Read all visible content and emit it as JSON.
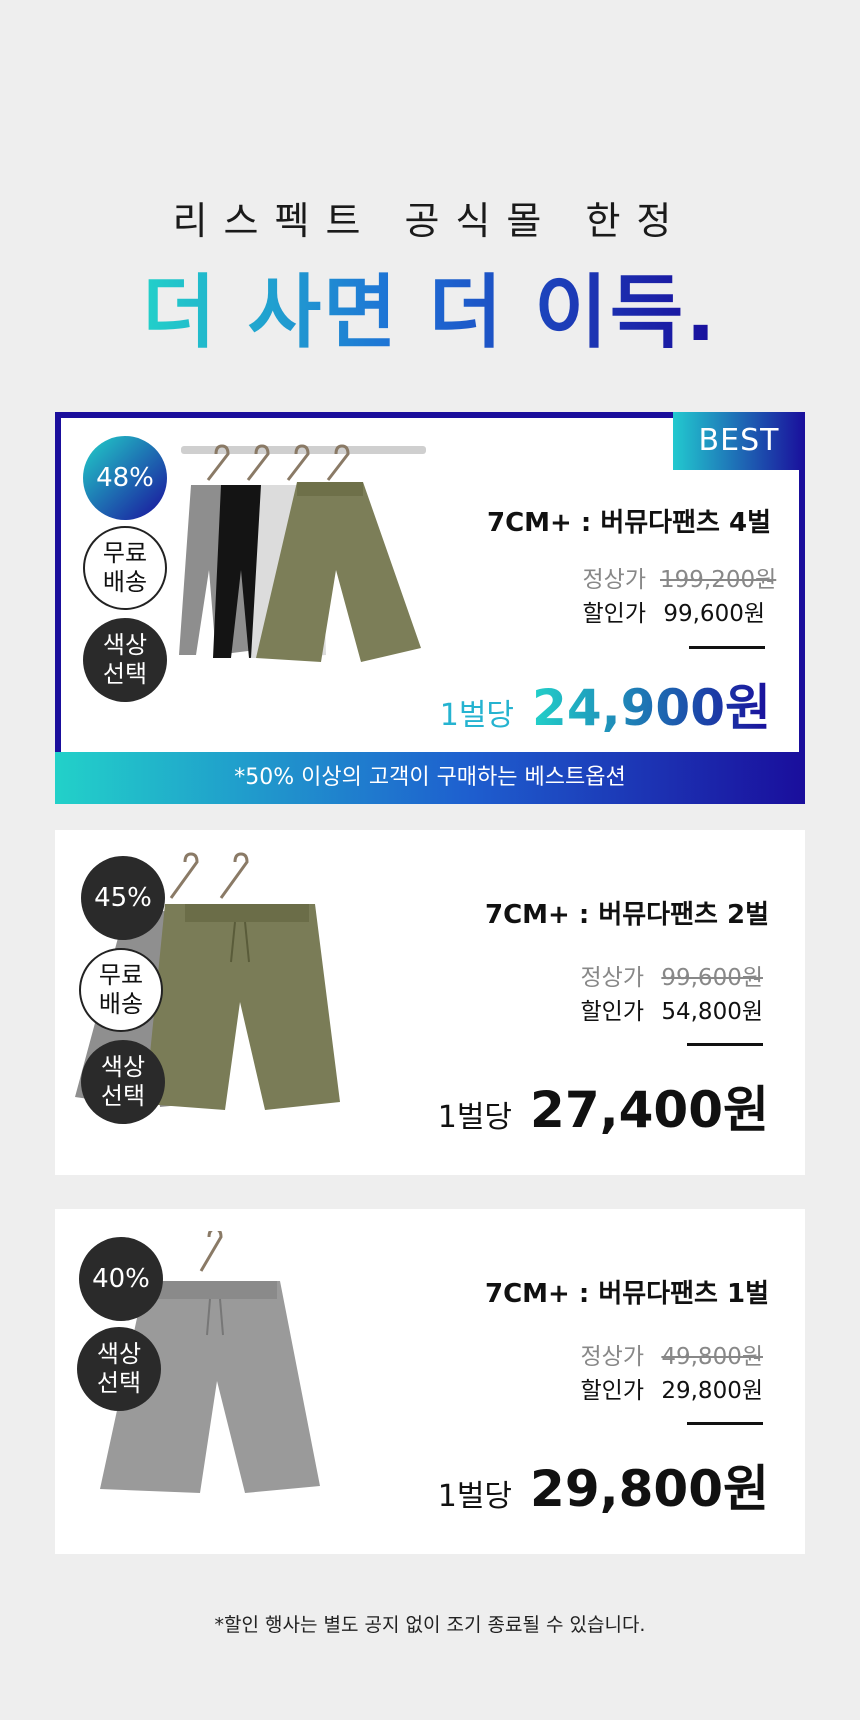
{
  "header": {
    "subtitle": "리스펙트 공식몰 한정",
    "headline": "더 사면 더 이득."
  },
  "products": [
    {
      "best_tag": "BEST",
      "discount": "48%",
      "badges": [
        "무료\n배송",
        "색상\n선택"
      ],
      "title": "7CM+ : 버뮤다팬츠 4벌",
      "original_label": "정상가",
      "original_price": "199,200원",
      "sale_label": "할인가",
      "sale_price": "99,600원",
      "unit_label": "1벌당",
      "unit_price": "24,900원",
      "banner": "*50% 이상의 고객이 구매하는 베스트옵션"
    },
    {
      "discount": "45%",
      "badges": [
        "무료\n배송",
        "색상\n선택"
      ],
      "title": "7CM+ : 버뮤다팬츠 2벌",
      "original_label": "정상가",
      "original_price": "99,600원",
      "sale_label": "할인가",
      "sale_price": "54,800원",
      "unit_label": "1벌당",
      "unit_price": "27,400원"
    },
    {
      "discount": "40%",
      "badges": [
        "색상\n선택"
      ],
      "title": "7CM+ : 버뮤다팬츠 1벌",
      "original_label": "정상가",
      "original_price": "49,800원",
      "sale_label": "할인가",
      "sale_price": "29,800원",
      "unit_label": "1벌당",
      "unit_price": "29,800원"
    }
  ],
  "footnote": "*할인 행사는 별도 공지 없이 조기 종료될 수 있습니다.",
  "colors": {
    "gradient_start": "#22d1c9",
    "gradient_end": "#1a0e9c",
    "best_border": "#1a0e9c",
    "badge_dark": "#2a2a2a",
    "page_bg": "#eeeeee"
  }
}
